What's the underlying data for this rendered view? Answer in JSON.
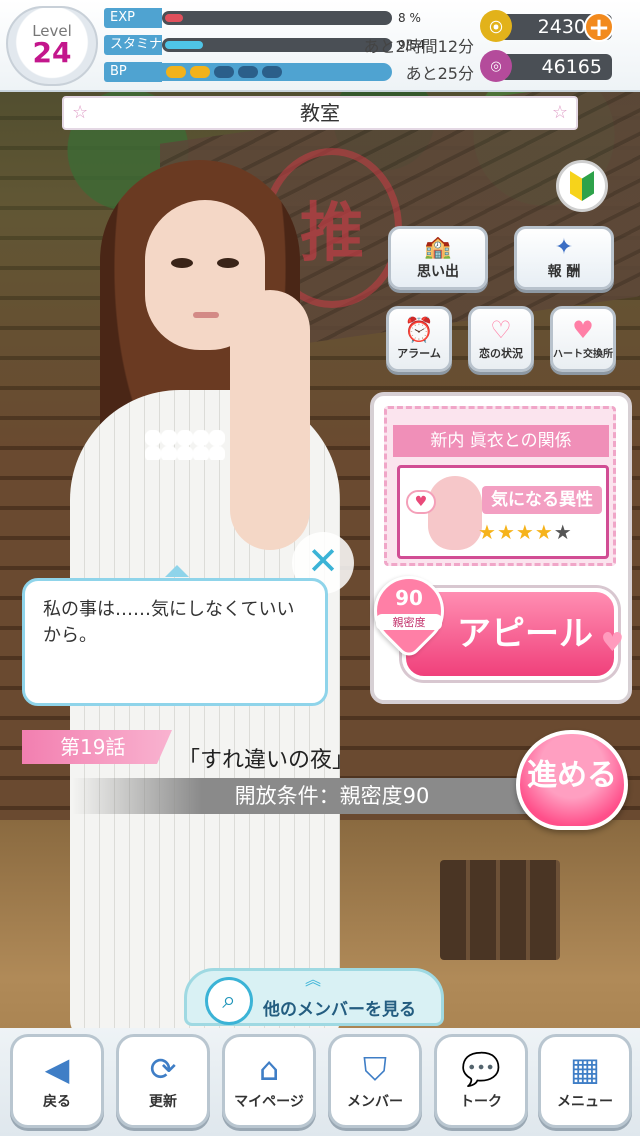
{
  "hud": {
    "level_label": "Level",
    "level_value": "24",
    "exp_label": "EXP",
    "exp_value": "8 %",
    "exp_percent": 8,
    "stamina_label": "スタミナ",
    "stamina_value": "9/54",
    "stamina_percent": 17,
    "stamina_recover": "あと2時間12分",
    "bp_label": "BP",
    "bp_filled": 2,
    "bp_total": 5,
    "bp_recover": "あと25分",
    "coins": "2430",
    "gems": "46165",
    "coin_color": "#e2b21a",
    "gem_color": "#b44b9b"
  },
  "location": "教室",
  "side_buttons": {
    "memories": "思い出",
    "rewards": "報 酬",
    "alarm": "アラーム",
    "love_status": "恋の状況",
    "heart_exchange": "ハート交換所"
  },
  "relationship": {
    "title": "新内 眞衣との関係",
    "status": "気になる異性",
    "stars_filled": 4,
    "stars_total": 5,
    "affinity": "90",
    "affinity_label": "親密度",
    "appeal_label": "アピール"
  },
  "speech": {
    "text": "私の事は……気にしなくていいから。"
  },
  "episode": {
    "tag": "第19話",
    "title": "「すれ違いの夜」",
    "condition": "開放条件：親密度90",
    "go_label": "進める"
  },
  "other_members": "他のメンバーを見る",
  "nav": {
    "back": "戻る",
    "refresh": "更新",
    "mypage": "マイページ",
    "members": "メンバー",
    "talk": "トーク",
    "menu": "メニュー"
  },
  "colors": {
    "accent_pink": "#f0407b",
    "accent_blue": "#4fa3d1"
  }
}
